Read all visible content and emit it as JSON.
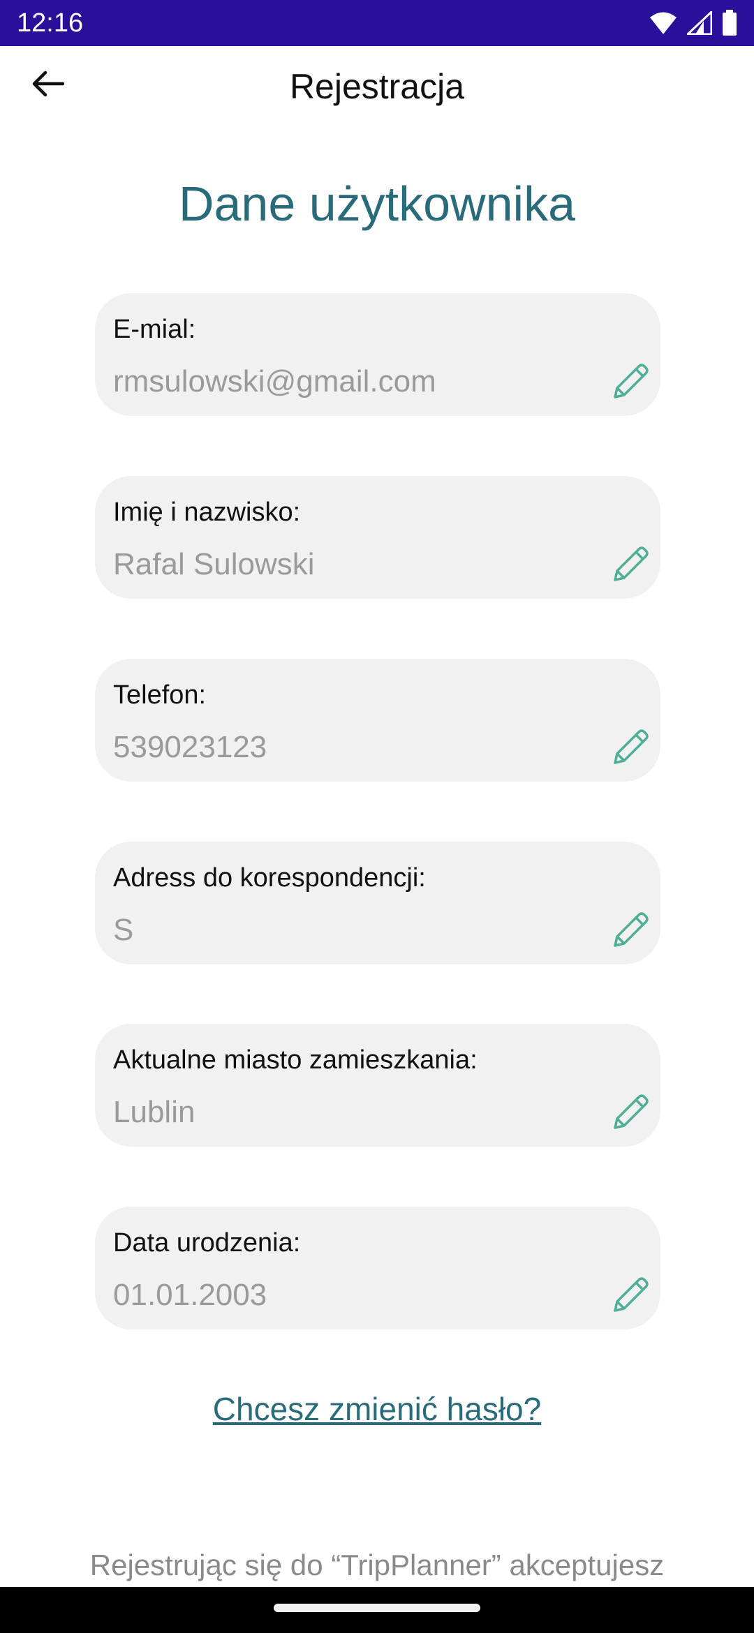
{
  "status_bar": {
    "time": "12:16",
    "icons": [
      "wifi-icon",
      "signal-icon",
      "battery-icon"
    ]
  },
  "app_bar": {
    "title": "Rejestracja",
    "back_icon": "arrow-left-icon"
  },
  "heading": "Dane użytkownika",
  "fields": [
    {
      "label": "E-mial:",
      "value": "rmsulowski@gmail.com"
    },
    {
      "label": "Imię i nazwisko:",
      "value": "Rafal Sulowski"
    },
    {
      "label": "Telefon:",
      "value": "539023123"
    },
    {
      "label": "Adress do korespondencji:",
      "value": "S"
    },
    {
      "label": "Aktualne miasto zamieszkania:",
      "value": "Lublin"
    },
    {
      "label": "Data urodzenia:",
      "value": "01.01.2003"
    }
  ],
  "change_password_link": "Chcesz zmienić hasło?",
  "terms_text": "Rejestrując się do “TripPlanner” akceptujesz",
  "colors": {
    "status_bar": "#2a0f9b",
    "accent": "#2a6b7a",
    "edit_icon": "#4fae96",
    "card": "#f1f1f1"
  }
}
